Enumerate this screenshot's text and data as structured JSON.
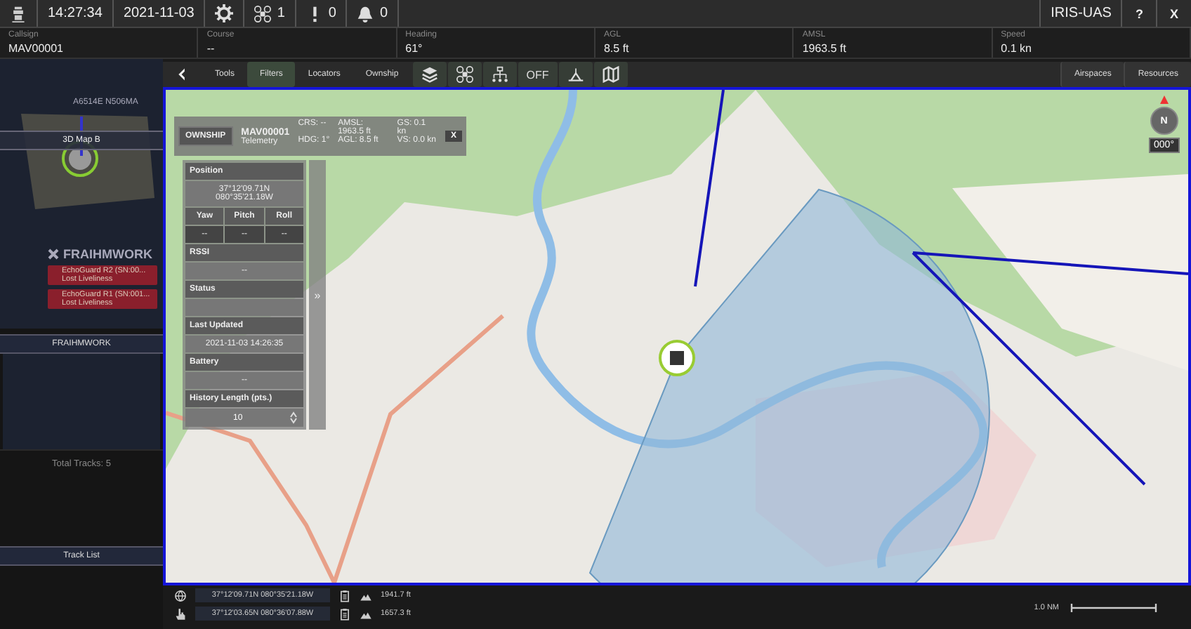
{
  "top_bar": {
    "time": "14:27:34",
    "date": "2021-11-03",
    "counters": [
      {
        "kind": "drone",
        "value": "1"
      },
      {
        "kind": "alert",
        "value": "0"
      },
      {
        "kind": "bell",
        "value": "0"
      }
    ],
    "app_name": "IRIS-UAS",
    "help": "?",
    "close": "X"
  },
  "telemetry": [
    {
      "label": "Callsign",
      "value": "MAV00001"
    },
    {
      "label": "Course",
      "value": "--"
    },
    {
      "label": "Heading",
      "value": "61°"
    },
    {
      "label": "AGL",
      "value": "8.5 ft"
    },
    {
      "label": "AMSL",
      "value": "1963.5 ft"
    },
    {
      "label": "Speed",
      "value": "0.1 kn"
    }
  ],
  "sidebar": {
    "map_caption": "A6514E N506MA",
    "map_label": "3D Map B",
    "group": {
      "name": "FRAIHMWORK",
      "alerts": [
        {
          "title": "EchoGuard R2 (SN:00...",
          "detail": "Lost Liveliness"
        },
        {
          "title": "EchoGuard R1 (SN:001...",
          "detail": "Lost Liveliness"
        }
      ]
    },
    "group_tab": "FRAIHMWORK",
    "total_tracks": "Total Tracks: 5",
    "track_list": "Track List"
  },
  "toolbar": {
    "tabs": [
      {
        "label": "Tools",
        "selected": false
      },
      {
        "label": "Filters",
        "selected": true
      },
      {
        "label": "Locators",
        "selected": false
      },
      {
        "label": "Ownship",
        "selected": false
      }
    ],
    "icons": [
      {
        "kind": "layers"
      },
      {
        "kind": "drone"
      },
      {
        "kind": "network"
      },
      {
        "kind": "text",
        "label": "OFF"
      },
      {
        "kind": "terrain"
      },
      {
        "kind": "map"
      }
    ],
    "right_buttons": [
      "Airspaces",
      "Resources"
    ]
  },
  "ownship": {
    "tab": "OWNSHIP",
    "callsign": "MAV00001",
    "subtitle": "Telemetry",
    "stats": [
      "CRS: --",
      "HDG: 1°",
      "AMSL: 1963.5 ft",
      "AGL: 8.5 ft",
      "GS: 0.1 kn",
      "VS: 0.0 kn"
    ],
    "close": "X",
    "expand": "»",
    "sections": [
      {
        "kind": "single",
        "title": "Position",
        "value": "37°12'09.71N 080°35'21.18W"
      },
      {
        "kind": "triple",
        "columns": [
          "Yaw",
          "Pitch",
          "Roll"
        ],
        "values": [
          "--",
          "--",
          "--"
        ]
      },
      {
        "kind": "single",
        "title": "RSSI",
        "value": "--"
      },
      {
        "kind": "single",
        "title": "Status"
      },
      {
        "kind": "single",
        "title": "Last Updated",
        "value": "2021-11-03 14:26:35"
      },
      {
        "kind": "single",
        "title": "Battery",
        "value": "--"
      },
      {
        "kind": "spinner",
        "title": "History Length (pts.)",
        "value": "10"
      }
    ]
  },
  "map": {
    "compass_letter": "N",
    "compass_heading": "000°"
  },
  "bottom_bar": {
    "rows": [
      {
        "kind": "globe",
        "coords": "37°12'09.71N 080°35'21.18W",
        "altitude": "1941.7 ft"
      },
      {
        "kind": "pointer",
        "coords": "37°12'03.65N 080°36'07.88W",
        "altitude": "1657.3 ft"
      }
    ],
    "scale": "1.0 NM"
  }
}
